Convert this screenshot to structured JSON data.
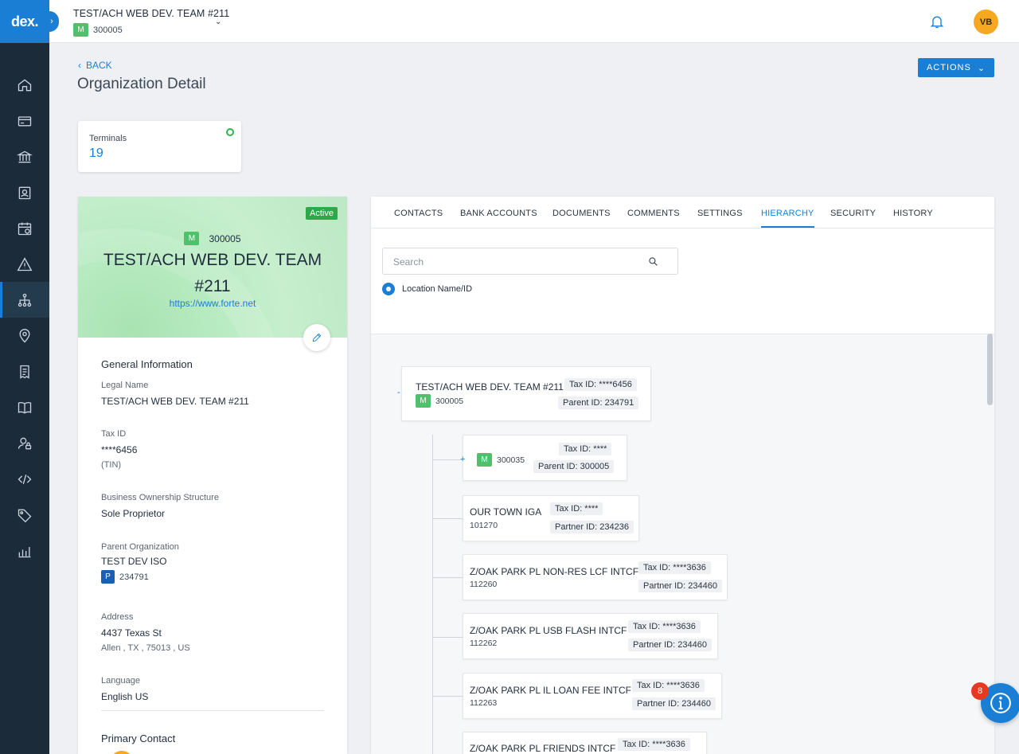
{
  "app": {
    "logo": "dex."
  },
  "topbar": {
    "org_name": "TEST/ACH WEB DEV. TEAM #211",
    "org_badge": "M",
    "org_id": "300005",
    "avatar_initials": "VB"
  },
  "header": {
    "back_label": "BACK",
    "title": "Organization Detail",
    "actions_label": "ACTIONS"
  },
  "terminals": {
    "label": "Terminals",
    "value": "19"
  },
  "profile": {
    "status": "Active",
    "badge": "M",
    "id": "300005",
    "name": "TEST/ACH WEB DEV. TEAM #211",
    "url": "https://www.forte.net",
    "general_title": "General Information",
    "legal_name_label": "Legal Name",
    "legal_name": "TEST/ACH WEB DEV. TEAM #211",
    "tax_id_label": "Tax ID",
    "tax_id": "****6456",
    "tax_id_type": "(TIN)",
    "ownership_label": "Business Ownership Structure",
    "ownership": "Sole Proprietor",
    "parent_label": "Parent Organization",
    "parent_name": "TEST DEV ISO",
    "parent_badge": "P",
    "parent_id": "234791",
    "address_label": "Address",
    "address_line1": "4437 Texas St",
    "address_line2": "Allen , TX , 75013 , US",
    "language_label": "Language",
    "language": "English US",
    "primary_contact_title": "Primary Contact"
  },
  "tabs": [
    "CONTACTS",
    "BANK ACCOUNTS",
    "DOCUMENTS",
    "COMMENTS",
    "SETTINGS",
    "HIERARCHY",
    "SECURITY",
    "HISTORY"
  ],
  "hierarchy": {
    "search_placeholder": "Search",
    "radio_label": "Location Name/ID",
    "root": {
      "name": "TEST/ACH WEB DEV. TEAM #211",
      "badge": "M",
      "id": "300005",
      "tax": "Tax ID: ****6456",
      "parent": "Parent ID: 234791",
      "toggle": "-"
    },
    "children": [
      {
        "name": "",
        "badge": "M",
        "id": "300035",
        "tax": "Tax ID: ****",
        "ref": "Parent ID: 300005",
        "toggle": "+"
      },
      {
        "name": "OUR TOWN IGA",
        "badge": "",
        "id": "101270",
        "tax": "Tax ID: ****",
        "ref": "Partner ID: 234236",
        "toggle": ""
      },
      {
        "name": "Z/OAK PARK PL NON-RES LCF INTCF",
        "badge": "",
        "id": "112260",
        "tax": "Tax ID: ****3636",
        "ref": "Partner ID: 234460",
        "toggle": ""
      },
      {
        "name": "Z/OAK PARK PL USB FLASH INTCF",
        "badge": "",
        "id": "112262",
        "tax": "Tax ID: ****3636",
        "ref": "Partner ID: 234460",
        "toggle": ""
      },
      {
        "name": "Z/OAK PARK PL IL LOAN FEE INTCF",
        "badge": "",
        "id": "112263",
        "tax": "Tax ID: ****3636",
        "ref": "Partner ID: 234460",
        "toggle": ""
      },
      {
        "name": "Z/OAK PARK PL FRIENDS INTCF",
        "badge": "",
        "id": "",
        "tax": "Tax ID: ****3636",
        "ref": "",
        "toggle": ""
      }
    ]
  },
  "help": {
    "count": "8"
  },
  "colors": {
    "accent": "#1a7fd4",
    "sidebar": "#1b2b3a",
    "active_green": "#2fa84a",
    "merchant_badge": "#4fc06c",
    "avatar": "#f6a821",
    "alert": "#e8391f"
  },
  "icons": {
    "nav": [
      "home-icon",
      "card-icon",
      "bank-icon",
      "contacts-icon",
      "calendar-icon",
      "alert-icon",
      "hierarchy-icon",
      "location-icon",
      "receipt-icon",
      "book-icon",
      "user-lock-icon",
      "code-icon",
      "tag-icon",
      "chart-icon"
    ]
  }
}
